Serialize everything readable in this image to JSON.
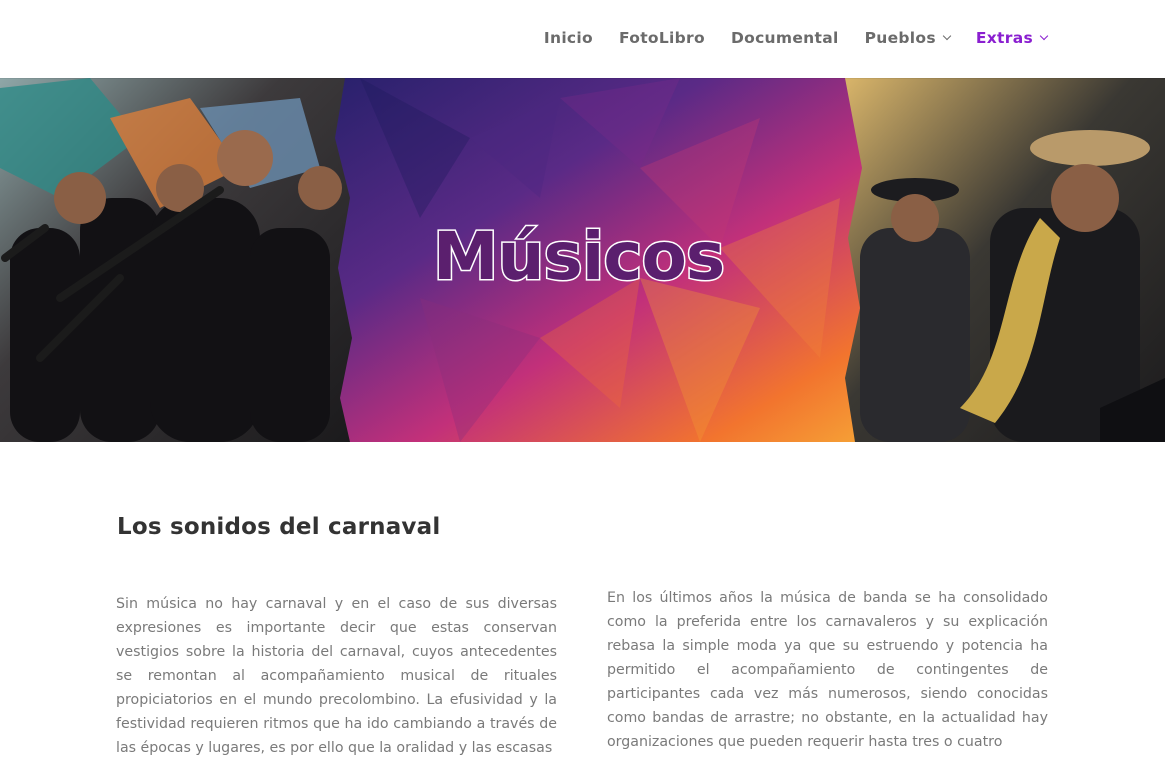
{
  "nav": {
    "items": [
      {
        "label": "Inicio",
        "has_dropdown": false,
        "active": false
      },
      {
        "label": "FotoLibro",
        "has_dropdown": false,
        "active": false
      },
      {
        "label": "Documental",
        "has_dropdown": false,
        "active": false
      },
      {
        "label": "Pueblos",
        "has_dropdown": true,
        "active": false
      },
      {
        "label": "Extras",
        "has_dropdown": true,
        "active": true
      }
    ],
    "active_color": "#8a1fd0"
  },
  "hero": {
    "title": "Músicos",
    "title_color": "#5b1f6e"
  },
  "section": {
    "title": "Los sonidos del carnaval",
    "left_paragraph": "Sin música no hay carnaval y en el caso de sus diversas expresiones es importante decir que estas conservan vestigios sobre la historia del carnaval, cuyos antecedentes se remontan al acompañamiento musical de rituales propiciatorios en el mundo precolombino. La efusividad y la festividad requieren ritmos que ha ido cambiando a través de las épocas y lugares, es por ello que la oralidad y las escasas",
    "right_paragraph": "En los últimos años la música de banda se ha consolidado como la preferida entre los carnavaleros y su explicación rebasa la simple moda ya que su estruendo y potencia ha permitido el acompañamiento de contingentes de participantes cada vez más numerosos, siendo conocidas como bandas de arrastre; no obstante, en la actualidad hay organizaciones que pueden requerir hasta tres o cuatro"
  }
}
